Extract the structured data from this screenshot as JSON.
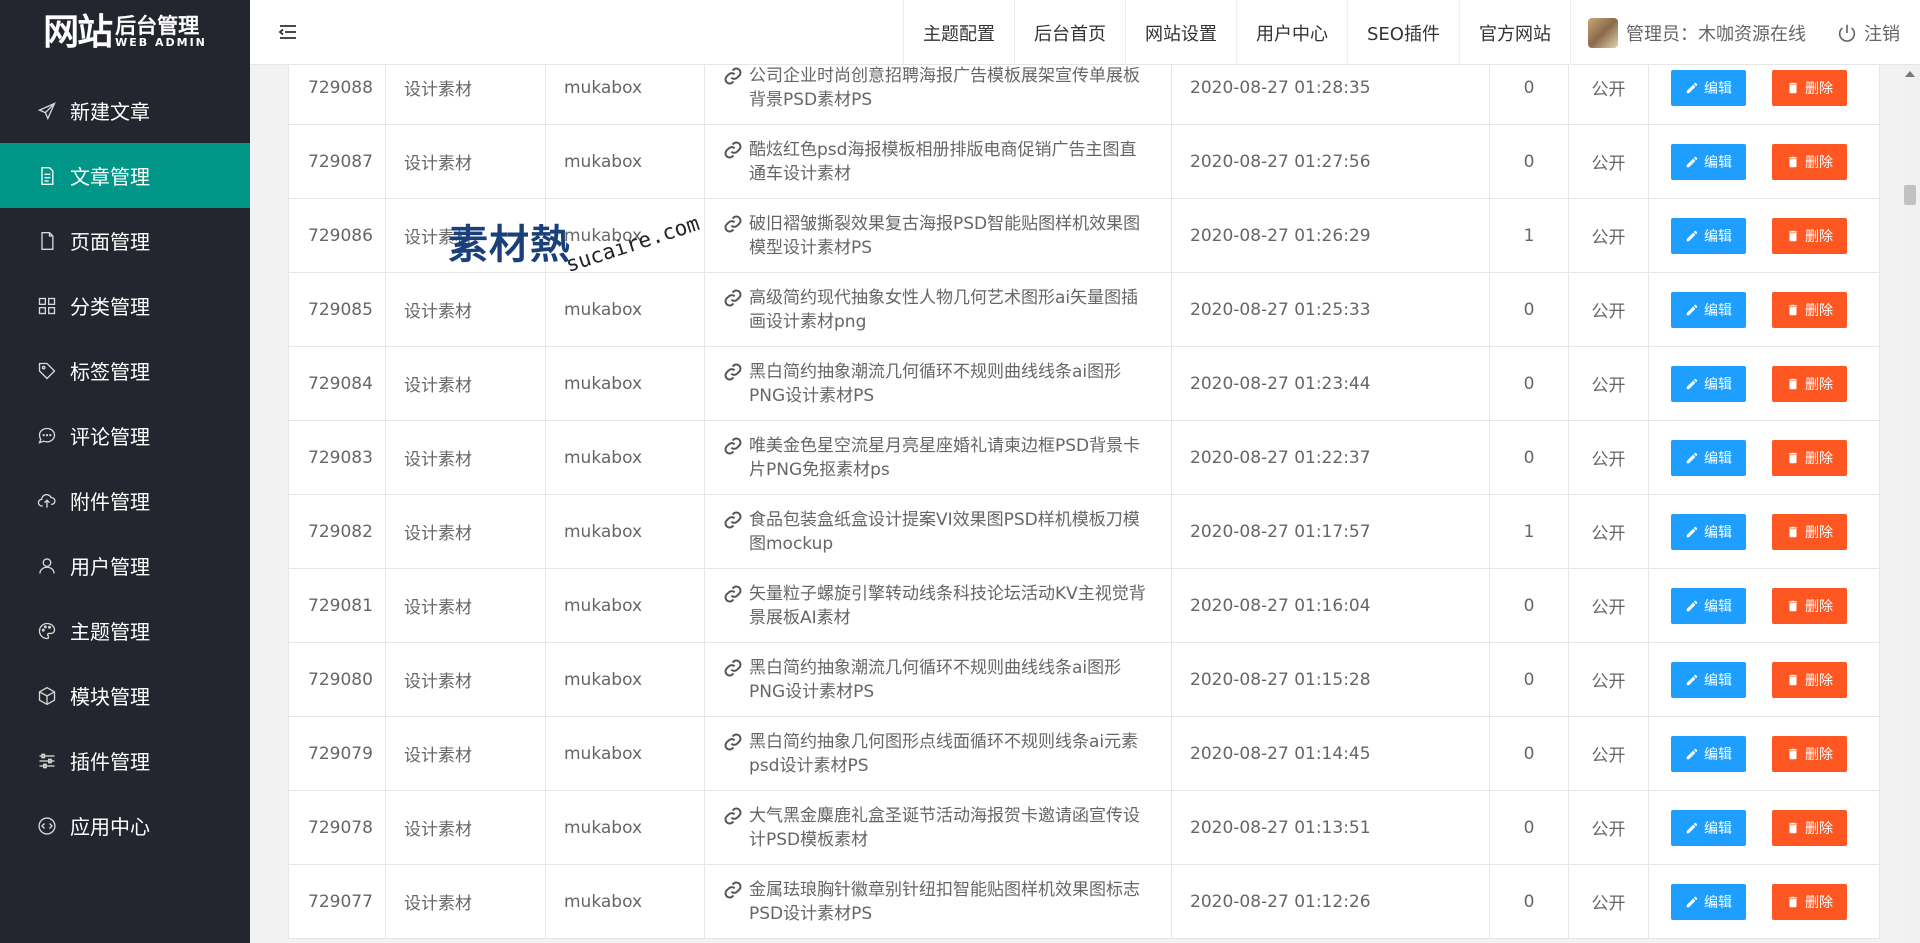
{
  "logo": {
    "main": "网站",
    "cn": "后台管理",
    "en": "WEB ADMIN"
  },
  "sidebar": {
    "items": [
      {
        "label": "新建文章",
        "icon": "send-icon",
        "active": false
      },
      {
        "label": "文章管理",
        "icon": "document-icon",
        "active": true
      },
      {
        "label": "页面管理",
        "icon": "file-icon",
        "active": false
      },
      {
        "label": "分类管理",
        "icon": "grid-icon",
        "active": false
      },
      {
        "label": "标签管理",
        "icon": "tag-icon",
        "active": false
      },
      {
        "label": "评论管理",
        "icon": "comment-icon",
        "active": false
      },
      {
        "label": "附件管理",
        "icon": "cloud-upload-icon",
        "active": false
      },
      {
        "label": "用户管理",
        "icon": "user-icon",
        "active": false
      },
      {
        "label": "主题管理",
        "icon": "palette-icon",
        "active": false
      },
      {
        "label": "模块管理",
        "icon": "cube-icon",
        "active": false
      },
      {
        "label": "插件管理",
        "icon": "sliders-icon",
        "active": false
      },
      {
        "label": "应用中心",
        "icon": "code-icon",
        "active": false
      }
    ]
  },
  "header": {
    "nav": [
      "主题配置",
      "后台首页",
      "网站设置",
      "用户中心",
      "SEO插件",
      "官方网站"
    ],
    "admin_label": "管理员：木咖资源在线",
    "logout_label": "注销"
  },
  "table": {
    "edit_label": "编辑",
    "delete_label": "删除",
    "rows": [
      {
        "id": "729088",
        "category": "设计素材",
        "author": "mukabox",
        "title": "公司企业时尚创意招聘海报广告模板展架宣传单展板背景PSD素材PS",
        "date": "2020-08-27 01:28:35",
        "views": "0",
        "status": "公开"
      },
      {
        "id": "729087",
        "category": "设计素材",
        "author": "mukabox",
        "title": "酷炫红色psd海报模板相册排版电商促销广告主图直通车设计素材",
        "date": "2020-08-27 01:27:56",
        "views": "0",
        "status": "公开"
      },
      {
        "id": "729086",
        "category": "设计素材",
        "author": "mukabox",
        "title": "破旧褶皱撕裂效果复古海报PSD智能贴图样机效果图模型设计素材PS",
        "date": "2020-08-27 01:26:29",
        "views": "1",
        "status": "公开"
      },
      {
        "id": "729085",
        "category": "设计素材",
        "author": "mukabox",
        "title": "高级简约现代抽象女性人物几何艺术图形ai矢量图插画设计素材png",
        "date": "2020-08-27 01:25:33",
        "views": "0",
        "status": "公开"
      },
      {
        "id": "729084",
        "category": "设计素材",
        "author": "mukabox",
        "title": "黑白简约抽象潮流几何循环不规则曲线线条ai图形PNG设计素材PS",
        "date": "2020-08-27 01:23:44",
        "views": "0",
        "status": "公开"
      },
      {
        "id": "729083",
        "category": "设计素材",
        "author": "mukabox",
        "title": "唯美金色星空流星月亮星座婚礼请柬边框PSD背景卡片PNG免抠素材ps",
        "date": "2020-08-27 01:22:37",
        "views": "0",
        "status": "公开"
      },
      {
        "id": "729082",
        "category": "设计素材",
        "author": "mukabox",
        "title": "食品包装盒纸盒设计提案VI效果图PSD样机模板刀模图mockup",
        "date": "2020-08-27 01:17:57",
        "views": "1",
        "status": "公开"
      },
      {
        "id": "729081",
        "category": "设计素材",
        "author": "mukabox",
        "title": "矢量粒子螺旋引擎转动线条科技论坛活动KV主视觉背景展板AI素材",
        "date": "2020-08-27 01:16:04",
        "views": "0",
        "status": "公开"
      },
      {
        "id": "729080",
        "category": "设计素材",
        "author": "mukabox",
        "title": "黑白简约抽象潮流几何循环不规则曲线线条ai图形PNG设计素材PS",
        "date": "2020-08-27 01:15:28",
        "views": "0",
        "status": "公开"
      },
      {
        "id": "729079",
        "category": "设计素材",
        "author": "mukabox",
        "title": "黑白简约抽象几何图形点线面循环不规则线条ai元素psd设计素材PS",
        "date": "2020-08-27 01:14:45",
        "views": "0",
        "status": "公开"
      },
      {
        "id": "729078",
        "category": "设计素材",
        "author": "mukabox",
        "title": "大气黑金麋鹿礼盒圣诞节活动海报贺卡邀请函宣传设计PSD模板素材",
        "date": "2020-08-27 01:13:51",
        "views": "0",
        "status": "公开"
      },
      {
        "id": "729077",
        "category": "设计素材",
        "author": "mukabox",
        "title": "金属珐琅胸针徽章别针纽扣智能贴图样机效果图标志PSD设计素材PS",
        "date": "2020-08-27 01:12:26",
        "views": "0",
        "status": "公开"
      }
    ]
  },
  "watermark": {
    "cn": "素材熱",
    "en": "sucaire.com"
  },
  "colors": {
    "sidebar_bg": "#23262e",
    "active": "#009688",
    "edit": "#1e9fff",
    "delete": "#ff5722"
  }
}
